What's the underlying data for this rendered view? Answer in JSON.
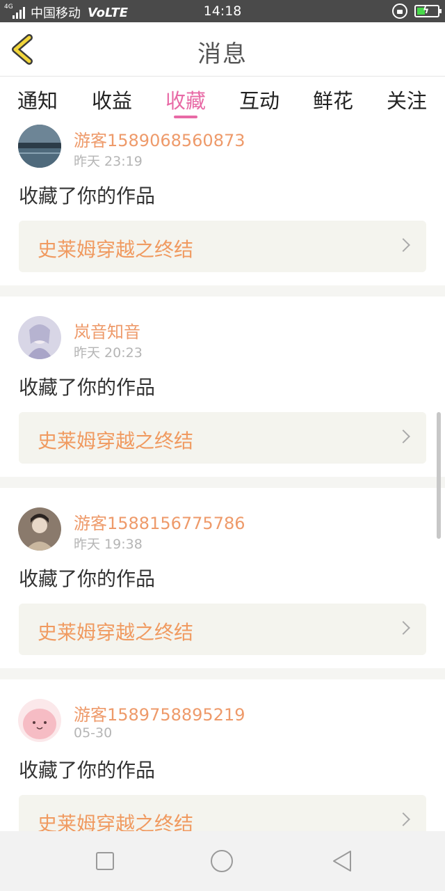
{
  "status_bar": {
    "network_tag": "4G",
    "carrier": "中国移动",
    "volte": "VoLTE",
    "time": "14:18",
    "battery_color": "#48d94a",
    "battery_level": 0.4
  },
  "header": {
    "title": "消息",
    "back_icon": "chevron-left-icon",
    "back_color": "#f2d63a"
  },
  "tabs": [
    {
      "label": "通知",
      "active": false
    },
    {
      "label": "收益",
      "active": false
    },
    {
      "label": "收藏",
      "active": true
    },
    {
      "label": "互动",
      "active": false
    },
    {
      "label": "鲜花",
      "active": false
    },
    {
      "label": "关注",
      "active": false
    }
  ],
  "accent_color": "#e86aa6",
  "messages": [
    {
      "username": "游客1589068560873",
      "time": "昨天 23:19",
      "action": "收藏了你的作品",
      "work_title": "史莱姆穿越之终结",
      "avatar": "lake-landscape-avatar"
    },
    {
      "username": "岚音知音",
      "time": "昨天 20:23",
      "action": "收藏了你的作品",
      "work_title": "史莱姆穿越之终结",
      "avatar": "anime-girl-avatar"
    },
    {
      "username": "游客1588156775786",
      "time": "昨天 19:38",
      "action": "收藏了你的作品",
      "work_title": "史莱姆穿越之终结",
      "avatar": "anime-boy-avatar"
    },
    {
      "username": "游客1589758895219",
      "time": "05-30",
      "action": "收藏了你的作品",
      "work_title": "史莱姆穿越之终结",
      "avatar": "pink-blob-avatar"
    }
  ],
  "nav": {
    "recent_icon": "square-icon",
    "home_icon": "circle-icon",
    "back_icon": "triangle-back-icon"
  }
}
